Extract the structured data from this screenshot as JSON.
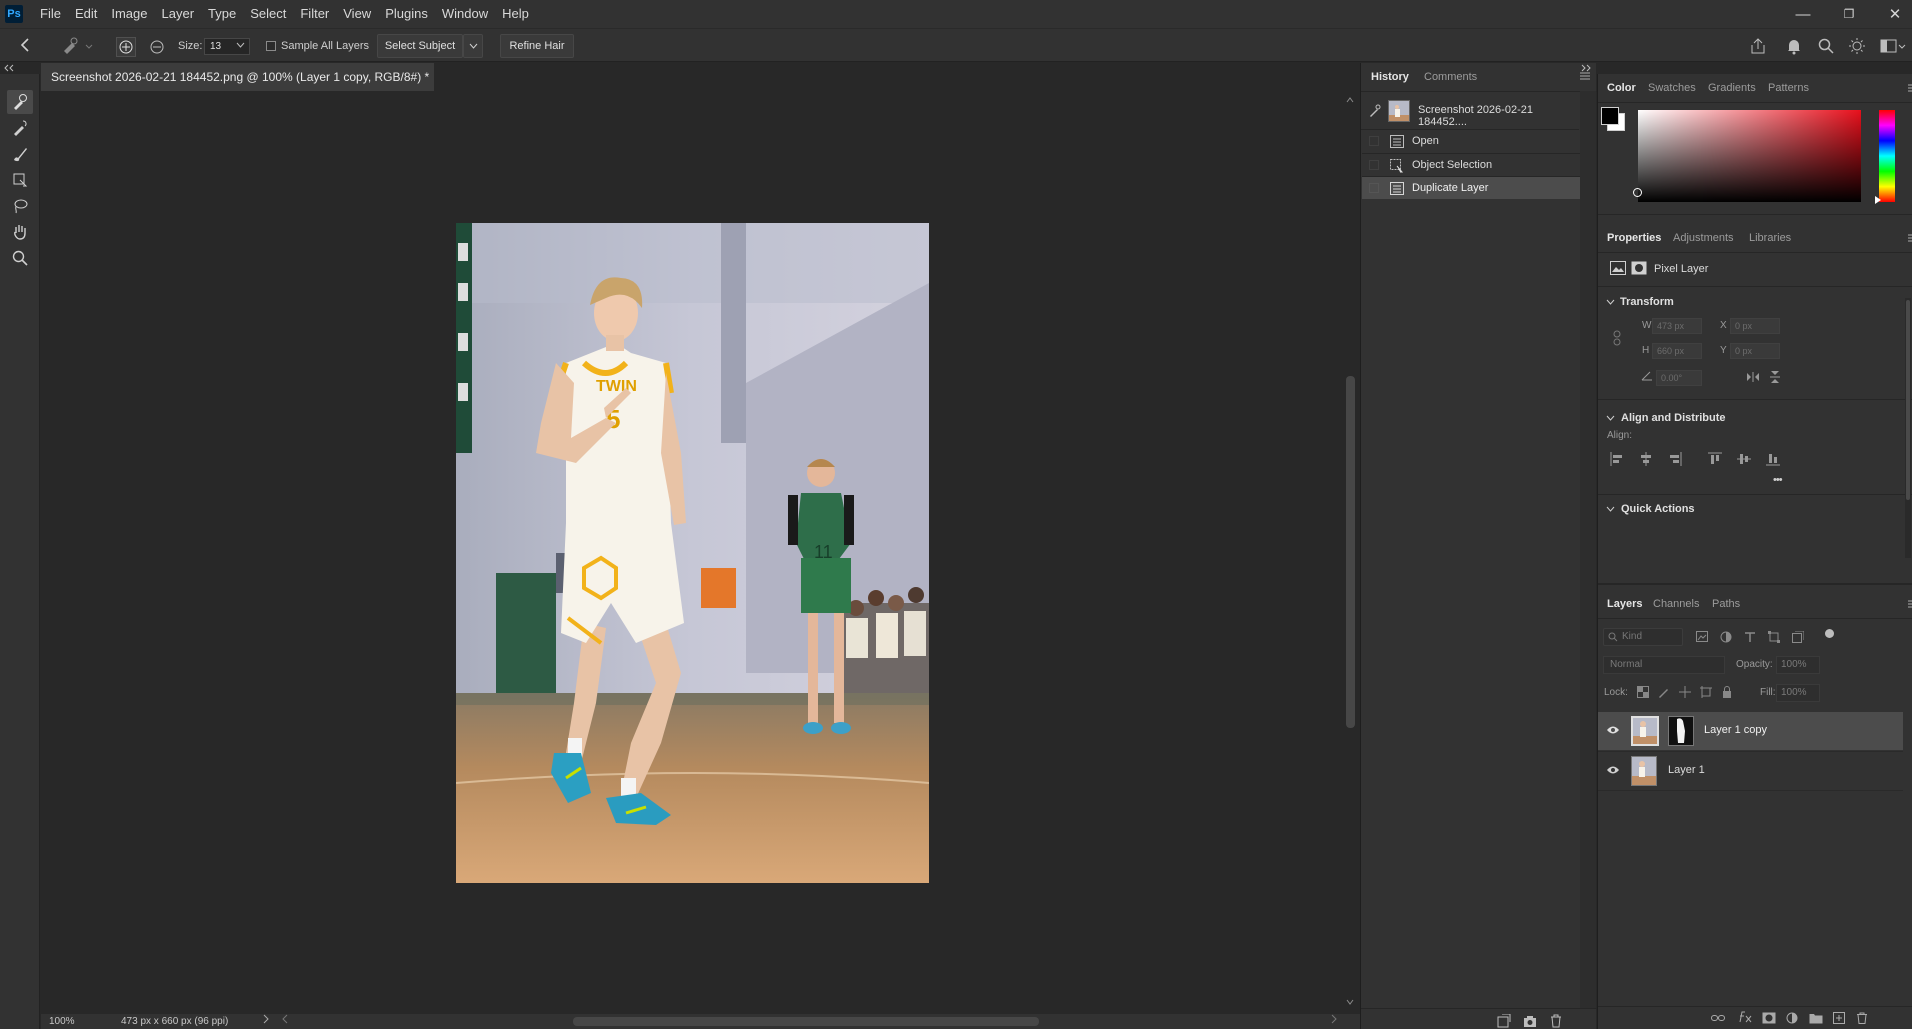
{
  "app": {
    "logo": "Ps",
    "menu": [
      "File",
      "Edit",
      "Image",
      "Layer",
      "Type",
      "Select",
      "Filter",
      "View",
      "Plugins",
      "Window",
      "Help"
    ],
    "window_controls": {
      "minimize": "—",
      "restore": "❐",
      "close": "✕"
    }
  },
  "options_bar": {
    "size_label": "Size:",
    "size_value": "13",
    "sample_all_layers": "Sample All Layers",
    "select_subject": "Select Subject",
    "refine_hair": "Refine Hair"
  },
  "document": {
    "tab_title": "Screenshot 2026-02-21 184452.png @ 100% (Layer 1 copy, RGB/8#) *",
    "tab_close": "×",
    "photo_jersey": "TWIN",
    "photo_number": "5",
    "photo_bg_number": "11"
  },
  "status": {
    "zoom": "100%",
    "doc_info": "473 px x 660 px (96 ppi)"
  },
  "history": {
    "tabs": [
      "History",
      "Comments"
    ],
    "snapshot": "Screenshot 2026-02-21 184452....",
    "items": [
      "Open",
      "Object Selection",
      "Duplicate Layer"
    ],
    "selected_index": 2
  },
  "color_panel": {
    "tabs": [
      "Color",
      "Swatches",
      "Gradients",
      "Patterns"
    ],
    "hue_color": "#e8101c",
    "foreground": "#000000",
    "background": "#ffffff"
  },
  "properties": {
    "tabs": [
      "Properties",
      "Adjustments",
      "Libraries"
    ],
    "layer_type": "Pixel Layer",
    "transform_title": "Transform",
    "w_label": "W",
    "w_value": "473 px",
    "h_label": "H",
    "h_value": "660 px",
    "x_label": "X",
    "x_value": "0 px",
    "y_label": "Y",
    "y_value": "0 px",
    "angle_value": "0.00°",
    "align_title": "Align and Distribute",
    "align_label": "Align:",
    "more": "•••",
    "quick_actions_title": "Quick Actions"
  },
  "layers_panel": {
    "tabs": [
      "Layers",
      "Channels",
      "Paths"
    ],
    "kind_placeholder": "Kind",
    "blend_mode": "Normal",
    "opacity_label": "Opacity:",
    "opacity_value": "100%",
    "lock_label": "Lock:",
    "fill_label": "Fill:",
    "fill_value": "100%",
    "layers": [
      "Layer 1 copy",
      "Layer 1"
    ],
    "selected_index": 0
  }
}
